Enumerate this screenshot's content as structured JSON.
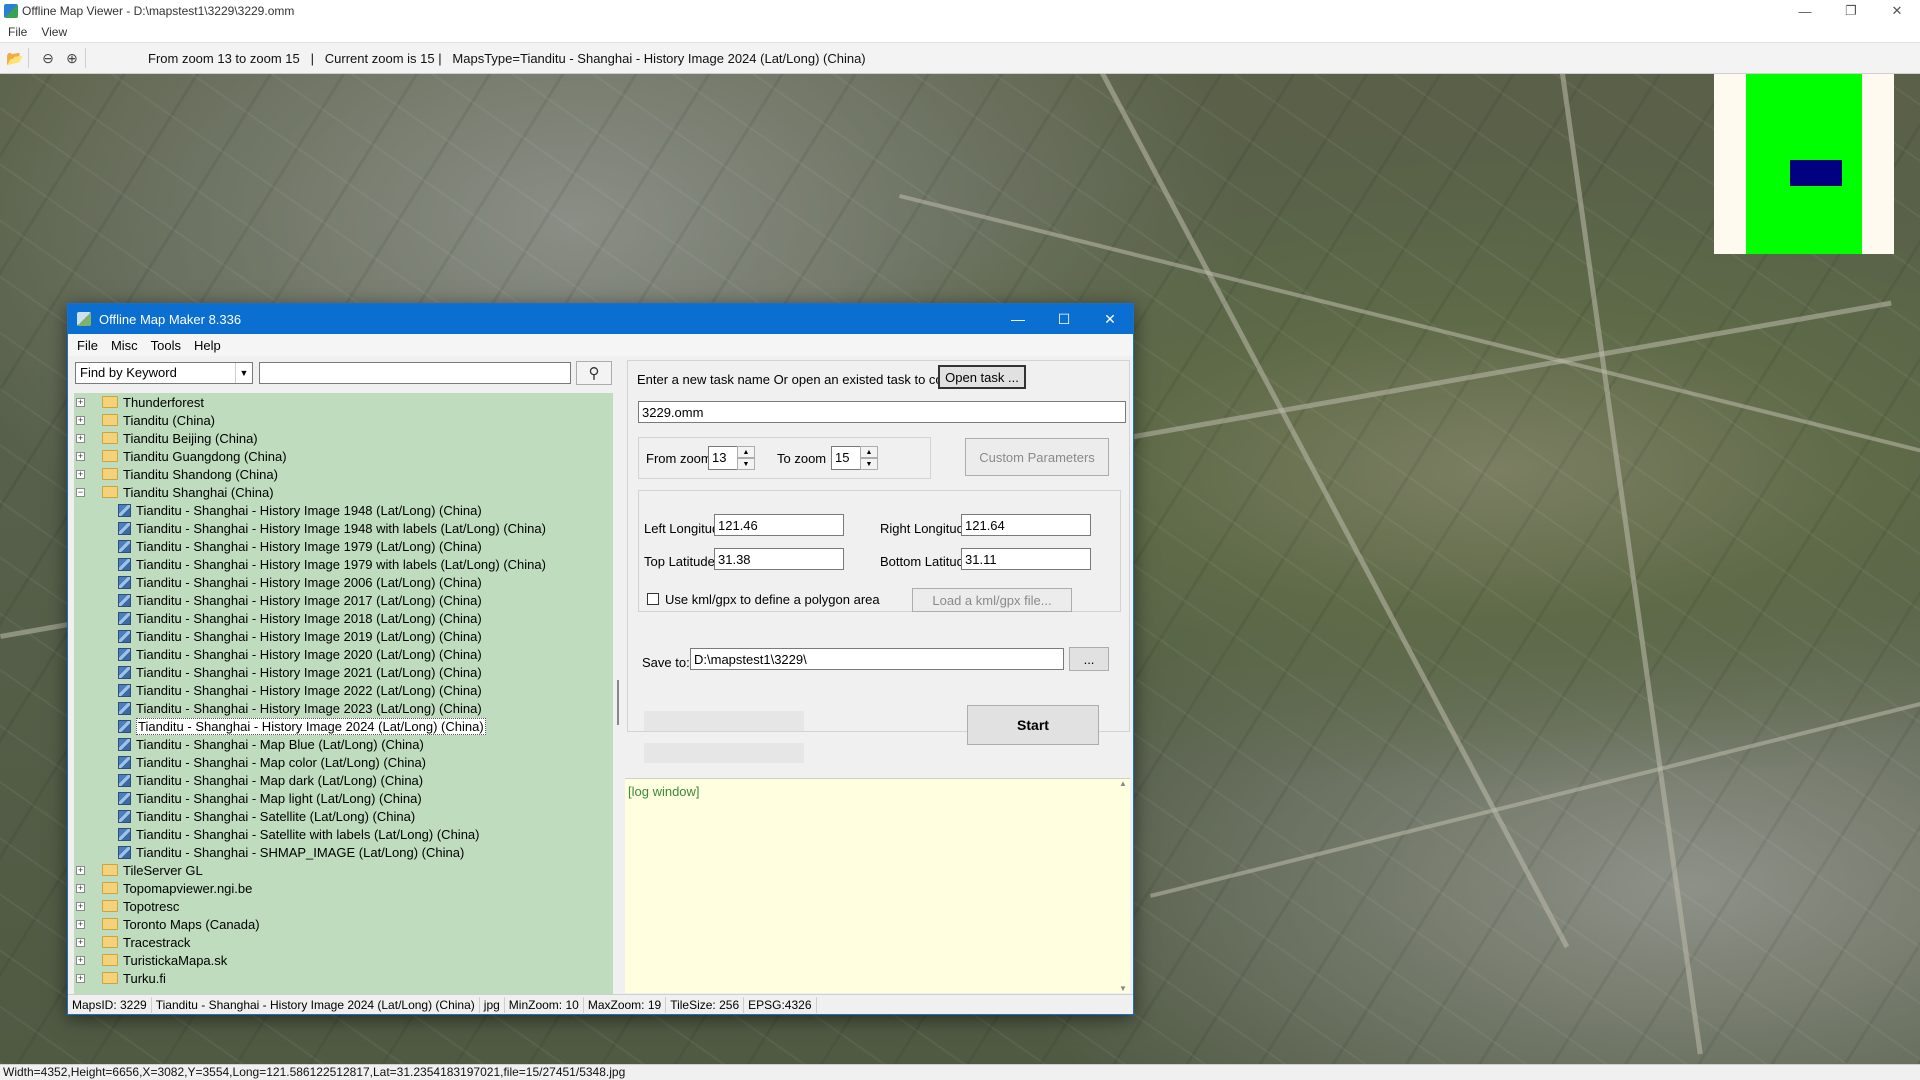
{
  "outer": {
    "title": "Offline Map Viewer - D:\\mapstest1\\3229\\3229.omm",
    "menu": [
      "File",
      "View"
    ],
    "status_info": "From zoom 13 to zoom 15   |   Current zoom is 15 |   MapsType=Tianditu - Shanghai - History Image 2024 (Lat/Long) (China)",
    "bottom_status": "Width=4352,Height=6656,X=3082,Y=3554,Long=121.586122512817,Lat=31.2354183197021,file=15/27451/5348.jpg",
    "icons": [
      "folder-open-icon",
      "zoom-out-icon",
      "zoom-in-icon"
    ]
  },
  "dialog": {
    "title": "Offline Map Maker 8.336",
    "menu": [
      "File",
      "Misc",
      "Tools",
      "Help"
    ],
    "find_mode": "Find by Keyword",
    "find_value": "",
    "tree": {
      "top_folders": [
        "Thunderforest",
        "Tianditu (China)",
        "Tianditu Beijing (China)",
        "Tianditu Guangdong (China)",
        "Tianditu Shandong (China)"
      ],
      "open_folder": "Tianditu Shanghai (China)",
      "children": [
        "Tianditu - Shanghai - History Image 1948 (Lat/Long) (China)",
        "Tianditu - Shanghai - History Image 1948 with labels (Lat/Long) (China)",
        "Tianditu - Shanghai - History Image 1979 (Lat/Long) (China)",
        "Tianditu - Shanghai - History Image 1979 with labels (Lat/Long) (China)",
        "Tianditu - Shanghai - History Image 2006 (Lat/Long) (China)",
        "Tianditu - Shanghai - History Image 2017 (Lat/Long) (China)",
        "Tianditu - Shanghai - History Image 2018 (Lat/Long) (China)",
        "Tianditu - Shanghai - History Image 2019 (Lat/Long) (China)",
        "Tianditu - Shanghai - History Image 2020 (Lat/Long) (China)",
        "Tianditu - Shanghai - History Image 2021 (Lat/Long) (China)",
        "Tianditu - Shanghai - History Image 2022 (Lat/Long) (China)",
        "Tianditu - Shanghai - History Image 2023 (Lat/Long) (China)",
        "Tianditu - Shanghai - History Image 2024 (Lat/Long) (China)",
        "Tianditu - Shanghai - Map Blue (Lat/Long) (China)",
        "Tianditu - Shanghai - Map color (Lat/Long) (China)",
        "Tianditu - Shanghai - Map dark (Lat/Long) (China)",
        "Tianditu - Shanghai - Map light (Lat/Long) (China)",
        "Tianditu - Shanghai - Satellite (Lat/Long) (China)",
        "Tianditu - Shanghai - Satellite with labels (Lat/Long) (China)",
        "Tianditu - Shanghai - SHMAP_IMAGE (Lat/Long) (China)"
      ],
      "selected_child": "Tianditu - Shanghai - History Image 2024 (Lat/Long) (China)",
      "bottom_folders": [
        "TileServer GL",
        "Topomapviewer.ngi.be",
        "Topotresc",
        "Toronto Maps (Canada)",
        "Tracestrack",
        "TuristickaMapa.sk",
        "Turku.fi"
      ]
    },
    "task_prompt": "Enter a new task name Or open an existed task to continue:",
    "open_task_label": "Open task ...",
    "task_name": "3229.omm",
    "from_zoom_label": "From zoom",
    "from_zoom": "13",
    "to_zoom_label": "To zoom",
    "to_zoom": "15",
    "custom_params_label": "Custom Parameters",
    "left_lon_label": "Left Longitude",
    "left_lon": "121.46",
    "right_lon_label": "Right Longitude",
    "right_lon": "121.64",
    "top_lat_label": "Top Latitude",
    "top_lat": "31.38",
    "bottom_lat_label": "Bottom Latitude",
    "bottom_lat": "31.11",
    "kml_label": "Use kml/gpx to define a polygon area",
    "kml_checked": false,
    "load_kml_label": "Load a kml/gpx file...",
    "save_to_label": "Save to:",
    "save_to": "D:\\mapstest1\\3229\\",
    "browse_label": "...",
    "start_label": "Start",
    "log_text": "[log window]",
    "status": {
      "maps_id": "MapsID: 3229",
      "map_name": "Tianditu - Shanghai - History Image 2024 (Lat/Long) (China)",
      "format": "jpg",
      "min_zoom": "MinZoom: 10",
      "max_zoom": "MaxZoom: 19",
      "tile_size": "TileSize: 256",
      "epsg": "EPSG:4326"
    }
  },
  "colors": {
    "titlebar_blue": "#0a6fd1",
    "tree_bg": "#bfdcbf",
    "log_bg": "#ffffe0",
    "minimap_green": "#00ff00",
    "minimap_view": "#000080"
  }
}
